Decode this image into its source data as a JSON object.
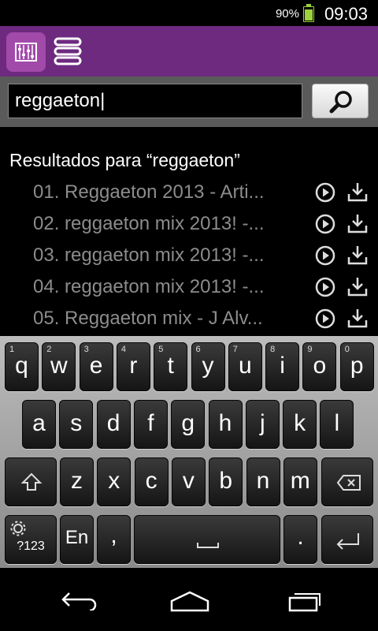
{
  "status_bar": {
    "battery_percent": "90%",
    "battery_level": 0.9,
    "time": "09:03"
  },
  "colors": {
    "app_bar": "#6d2a7f",
    "logo": "#a14aa9",
    "battery": "#9bd13c"
  },
  "search": {
    "value": "reggaeton|"
  },
  "results": {
    "title": "Resultados para “reggaeton”",
    "items": [
      {
        "label": "01. Reggaeton 2013 - Arti..."
      },
      {
        "label": "02. reggaeton mix 2013! -..."
      },
      {
        "label": "03. reggaeton mix 2013! -..."
      },
      {
        "label": "04. reggaeton mix 2013! -..."
      },
      {
        "label": "05. Reggaeton mix - J Alv..."
      }
    ]
  },
  "keyboard": {
    "row1": [
      {
        "key": "q",
        "hint": "1"
      },
      {
        "key": "w",
        "hint": "2"
      },
      {
        "key": "e",
        "hint": "3"
      },
      {
        "key": "r",
        "hint": "4"
      },
      {
        "key": "t",
        "hint": "5"
      },
      {
        "key": "y",
        "hint": "6"
      },
      {
        "key": "u",
        "hint": "7"
      },
      {
        "key": "i",
        "hint": "8"
      },
      {
        "key": "o",
        "hint": "9"
      },
      {
        "key": "p",
        "hint": "0"
      }
    ],
    "row2": [
      "a",
      "s",
      "d",
      "f",
      "g",
      "h",
      "j",
      "k",
      "l"
    ],
    "row3": [
      "z",
      "x",
      "c",
      "v",
      "b",
      "n",
      "m"
    ],
    "symbols_label": "?123",
    "language_label": "En",
    "comma_label": ",",
    "period_label": "."
  }
}
